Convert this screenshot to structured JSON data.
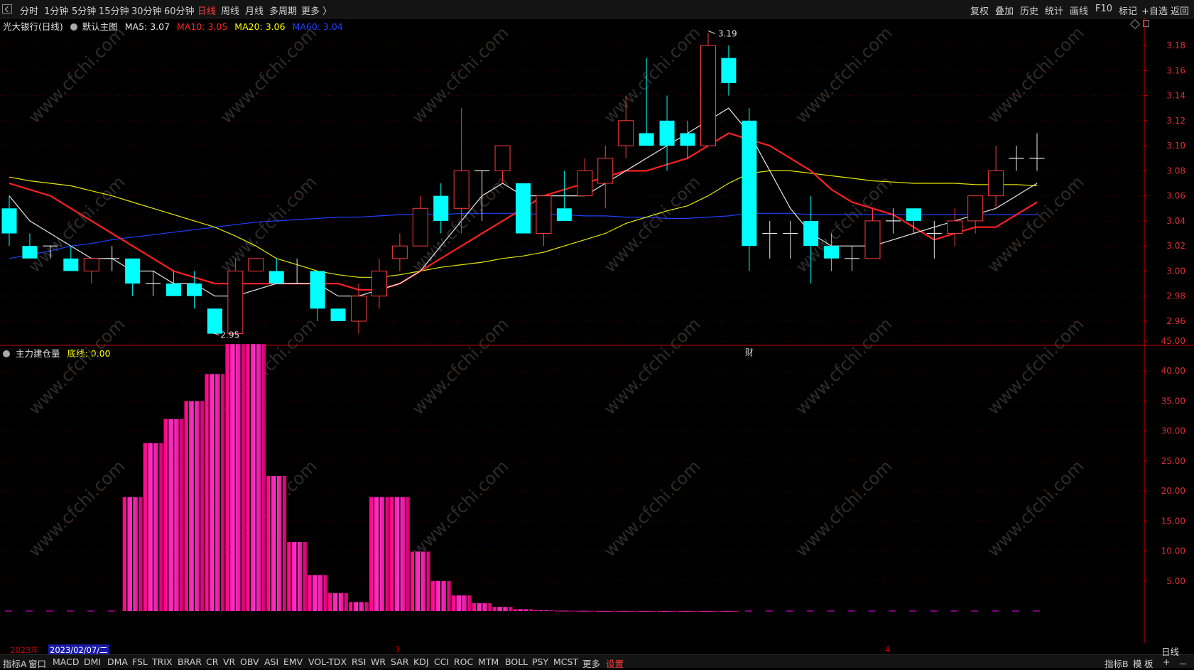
{
  "toolbar": {
    "periods": [
      "分时",
      "1分钟",
      "5分钟",
      "15分钟",
      "30分钟",
      "60分钟",
      "日线",
      "周线",
      "月线",
      "多周期",
      "更多 〉"
    ],
    "active_period": "日线",
    "right_buttons": [
      "复权",
      "叠加",
      "历史",
      "统计",
      "画线",
      "F10",
      "标记",
      "+自选",
      "返回"
    ]
  },
  "main_info": {
    "stock_name": "光大银行(日线)",
    "template": "默认主图",
    "ma5": {
      "label": "MA5: 3.07",
      "color": "#e8e8e8"
    },
    "ma10": {
      "label": "MA10: 3.05",
      "color": "#ff2020"
    },
    "ma20": {
      "label": "MA20: 3.06",
      "color": "#ffff00"
    },
    "ma60": {
      "label": "MA60: 3.04",
      "color": "#2040ff"
    }
  },
  "sub_info": {
    "indicator_name": "主力建仓量",
    "baseline_label": "底线: 0.00",
    "baseline_color": "#ffff00"
  },
  "annotations": {
    "high_label": "3.19",
    "low_label": "2.95",
    "marker": "财"
  },
  "watermark": "www.cfchi.com",
  "time_axis": {
    "year": "2023年",
    "cursor_date": "2023/02/07/二",
    "month_3": "3",
    "month_4": "4"
  },
  "bottom_tabs": [
    "指标A",
    "窗口",
    "MACD",
    "DMI",
    "DMA",
    "FSL",
    "TRIX",
    "BRAR",
    "CR",
    "VR",
    "OBV",
    "ASI",
    "EMV",
    "VOL-TDX",
    "RSI",
    "WR",
    "SAR",
    "KDJ",
    "CCI",
    "ROC",
    "MTM",
    "BOLL",
    "PSY",
    "MCST",
    "更多",
    "设置"
  ],
  "bottom_right": [
    "指标B",
    "模",
    "板",
    "+",
    "－"
  ],
  "bottom_period_label": "日线",
  "colors": {
    "up": "#ff3c3c",
    "down": "#00ffff",
    "bar_pink": "#ff1aa8",
    "axis": "#c80000"
  },
  "chart_data": [
    {
      "type": "candlestick",
      "ylim": [
        2.945,
        3.195
      ],
      "y_ticks": [
        "3.18",
        "3.16",
        "3.14",
        "3.12",
        "3.10",
        "3.08",
        "3.06",
        "3.04",
        "3.02",
        "3.00",
        "2.98",
        "2.96"
      ],
      "candles": [
        [
          3.05,
          3.06,
          3.02,
          3.03
        ],
        [
          3.02,
          3.03,
          3.01,
          3.01
        ],
        [
          3.02,
          3.02,
          3.01,
          3.02
        ],
        [
          3.01,
          3.02,
          3.0,
          3.0
        ],
        [
          3.0,
          3.01,
          2.99,
          3.01
        ],
        [
          3.01,
          3.02,
          3.0,
          3.01
        ],
        [
          3.01,
          3.01,
          2.98,
          2.99
        ],
        [
          2.99,
          3.0,
          2.98,
          2.99
        ],
        [
          2.99,
          3.0,
          2.98,
          2.98
        ],
        [
          2.99,
          3.0,
          2.97,
          2.98
        ],
        [
          2.97,
          2.97,
          2.95,
          2.95
        ],
        [
          2.95,
          3.01,
          2.95,
          3.0
        ],
        [
          3.0,
          3.01,
          3.0,
          3.01
        ],
        [
          3.0,
          3.01,
          2.99,
          2.99
        ],
        [
          2.99,
          3.01,
          2.99,
          2.99
        ],
        [
          3.0,
          3.0,
          2.96,
          2.97
        ],
        [
          2.97,
          2.97,
          2.96,
          2.96
        ],
        [
          2.96,
          2.99,
          2.95,
          2.98
        ],
        [
          2.98,
          3.01,
          2.97,
          3.0
        ],
        [
          3.01,
          3.03,
          3.0,
          3.02
        ],
        [
          3.02,
          3.06,
          3.02,
          3.05
        ],
        [
          3.06,
          3.07,
          3.03,
          3.04
        ],
        [
          3.05,
          3.13,
          3.03,
          3.08
        ],
        [
          3.08,
          3.08,
          3.04,
          3.08
        ],
        [
          3.08,
          3.1,
          3.07,
          3.1
        ],
        [
          3.07,
          3.07,
          3.03,
          3.03
        ],
        [
          3.03,
          3.06,
          3.02,
          3.06
        ],
        [
          3.05,
          3.08,
          3.04,
          3.04
        ],
        [
          3.06,
          3.09,
          3.06,
          3.08
        ],
        [
          3.07,
          3.1,
          3.05,
          3.09
        ],
        [
          3.1,
          3.14,
          3.09,
          3.12
        ],
        [
          3.11,
          3.17,
          3.1,
          3.1
        ],
        [
          3.12,
          3.14,
          3.08,
          3.1
        ],
        [
          3.11,
          3.12,
          3.09,
          3.1
        ],
        [
          3.1,
          3.19,
          3.1,
          3.18
        ],
        [
          3.17,
          3.18,
          3.14,
          3.15
        ],
        [
          3.12,
          3.13,
          3.0,
          3.02
        ],
        [
          3.03,
          3.04,
          3.01,
          3.03
        ],
        [
          3.03,
          3.04,
          3.01,
          3.03
        ],
        [
          3.04,
          3.06,
          2.99,
          3.02
        ],
        [
          3.02,
          3.03,
          3.0,
          3.01
        ],
        [
          3.01,
          3.02,
          3.0,
          3.01
        ],
        [
          3.01,
          3.05,
          3.01,
          3.04
        ],
        [
          3.04,
          3.05,
          3.03,
          3.04
        ],
        [
          3.05,
          3.05,
          3.03,
          3.04
        ],
        [
          3.03,
          3.04,
          3.01,
          3.03
        ],
        [
          3.03,
          3.05,
          3.02,
          3.04
        ],
        [
          3.04,
          3.06,
          3.03,
          3.06
        ],
        [
          3.06,
          3.1,
          3.05,
          3.08
        ],
        [
          3.09,
          3.1,
          3.08,
          3.09
        ],
        [
          3.09,
          3.11,
          3.08,
          3.09
        ]
      ],
      "ma5": [
        3.06,
        3.04,
        3.03,
        3.02,
        3.01,
        3.01,
        3.0,
        3.0,
        2.99,
        2.99,
        2.98,
        2.98,
        2.985,
        2.99,
        2.99,
        2.99,
        2.98,
        2.98,
        2.985,
        2.99,
        3.0,
        3.02,
        3.04,
        3.06,
        3.07,
        3.06,
        3.06,
        3.06,
        3.06,
        3.07,
        3.08,
        3.09,
        3.1,
        3.11,
        3.12,
        3.13,
        3.11,
        3.08,
        3.05,
        3.03,
        3.02,
        3.02,
        3.02,
        3.025,
        3.03,
        3.035,
        3.04,
        3.045,
        3.05,
        3.06,
        3.07
      ],
      "ma10": [
        3.07,
        3.065,
        3.06,
        3.05,
        3.04,
        3.03,
        3.02,
        3.01,
        3.0,
        2.995,
        2.99,
        2.99,
        2.99,
        2.99,
        2.99,
        2.99,
        2.99,
        2.985,
        2.985,
        2.99,
        3.0,
        3.01,
        3.02,
        3.03,
        3.04,
        3.05,
        3.06,
        3.065,
        3.07,
        3.075,
        3.08,
        3.08,
        3.085,
        3.09,
        3.1,
        3.11,
        3.105,
        3.1,
        3.09,
        3.08,
        3.065,
        3.055,
        3.05,
        3.045,
        3.035,
        3.025,
        3.03,
        3.035,
        3.035,
        3.045,
        3.055
      ],
      "ma20": [
        3.075,
        3.072,
        3.07,
        3.068,
        3.064,
        3.06,
        3.055,
        3.05,
        3.045,
        3.04,
        3.035,
        3.028,
        3.02,
        3.01,
        3.005,
        3.0,
        2.997,
        2.995,
        2.995,
        2.997,
        3.0,
        3.003,
        3.005,
        3.007,
        3.01,
        3.012,
        3.015,
        3.02,
        3.025,
        3.03,
        3.038,
        3.043,
        3.048,
        3.052,
        3.06,
        3.07,
        3.078,
        3.08,
        3.08,
        3.078,
        3.076,
        3.074,
        3.072,
        3.071,
        3.07,
        3.07,
        3.07,
        3.069,
        3.069,
        3.069,
        3.068
      ],
      "ma60": [
        3.01,
        3.013,
        3.016,
        3.02,
        3.022,
        3.025,
        3.027,
        3.029,
        3.031,
        3.033,
        3.035,
        3.037,
        3.039,
        3.04,
        3.041,
        3.042,
        3.043,
        3.043,
        3.044,
        3.045,
        3.045,
        3.045,
        3.046,
        3.046,
        3.046,
        3.046,
        3.045,
        3.045,
        3.044,
        3.044,
        3.043,
        3.043,
        3.042,
        3.042,
        3.043,
        3.044,
        3.046,
        3.046,
        3.046,
        3.045,
        3.045,
        3.045,
        3.045,
        3.045,
        3.045,
        3.045,
        3.045,
        3.045,
        3.045,
        3.045,
        3.045
      ]
    },
    {
      "type": "bar",
      "title": "主力建仓量",
      "ylim": [
        0,
        45
      ],
      "y_ticks": [
        "45.00",
        "40.00",
        "35.00",
        "30.00",
        "25.00",
        "20.00",
        "15.00",
        "10.00",
        "5.00"
      ],
      "values": [
        0,
        0,
        0,
        0,
        0,
        0,
        19,
        28,
        32,
        35,
        39.5,
        44.5,
        44.5,
        22.5,
        11.5,
        6,
        3,
        1.5,
        19,
        19,
        9.9,
        5,
        2.6,
        1.3,
        0.7,
        0.3,
        0.12,
        0.06,
        0.04,
        0.02,
        0.02,
        0.02,
        0.02,
        0.02,
        0.02,
        0.02,
        0,
        0,
        0,
        0,
        0,
        0,
        0,
        0,
        0,
        0,
        0,
        0,
        0,
        0,
        0
      ]
    }
  ]
}
